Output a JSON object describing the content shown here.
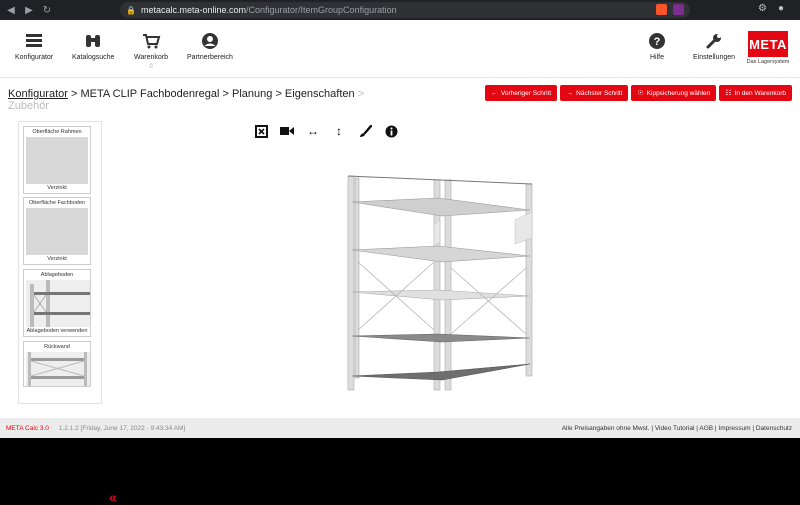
{
  "browser": {
    "url_host": "metacalc.meta-online.com",
    "url_path": "/Configurator/ItemGroupConfiguration"
  },
  "header": {
    "nav": [
      {
        "label": "Konfigurator"
      },
      {
        "label": "Katalogsuche"
      },
      {
        "label": "Warenkorb",
        "count": "0"
      },
      {
        "label": "Partnerbereich"
      }
    ],
    "help_label": "Hilfe",
    "settings_label": "Einstellungen",
    "logo_text": "META",
    "logo_sub": "Das Lagersystem"
  },
  "breadcrumb": {
    "home": "Konfigurator",
    "path": " > META CLIP Fachbodenregal > Planung > Eigenschaften ",
    "sep": ">",
    "last": "Zubehör"
  },
  "actions": {
    "prev": "Vorheriger Schritt",
    "next": "Nächster Schritt",
    "tilt": "Kippsicherung wählen",
    "cart": "In den Warenkorb"
  },
  "side_cards": [
    {
      "title": "Oberfläche Rahmen",
      "footer": "Verzinkt"
    },
    {
      "title": "Oberfläche Fachboden",
      "footer": "Verzinkt"
    },
    {
      "title": "Ablageboden",
      "footer": "Ablageboden verwenden"
    },
    {
      "title": "Rückwand",
      "footer": ""
    }
  ],
  "footer": {
    "brand": "META Calc 3.0",
    "version": "1.2.1.2 [Friday, June 17, 2022 - 9:43:34 AM]",
    "links": "Alle Preisangaben ohne Mwst. | Video Tutorial  | AGB  | Impressum  | Datenschutz"
  },
  "colors": {
    "accent": "#e30613",
    "footer_bg": "#ececec"
  }
}
